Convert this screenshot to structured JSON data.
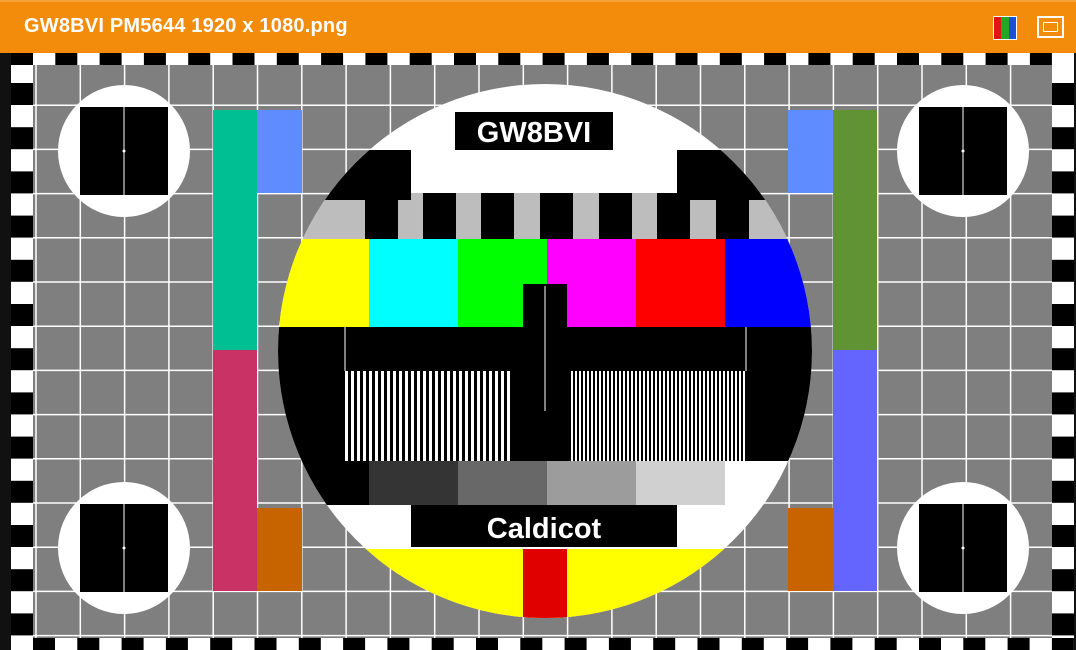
{
  "window": {
    "title": "GW8BVI PM5644 1920 x 1080.png",
    "icons": [
      "color-mode-icon",
      "maximize-icon"
    ]
  },
  "test_card": {
    "callsign": "GW8BVI",
    "location": "Caldicot",
    "pattern": "PM5644"
  },
  "colors": {
    "titlebar": "#f38c0b",
    "background_grey": "#7f7f7f",
    "grid_lines": "#ffffff",
    "bars": [
      "#ffff00",
      "#00ffff",
      "#00ff00",
      "#ff00ff",
      "#ff0000",
      "#0000ff"
    ],
    "left_side_top": "#00c093",
    "left_side_bottom": "#c83264",
    "right_side_top": "#5f9334",
    "right_side_bottom": "#6464ff",
    "light_blue": "#5f8dff",
    "orange": "#c86400"
  }
}
